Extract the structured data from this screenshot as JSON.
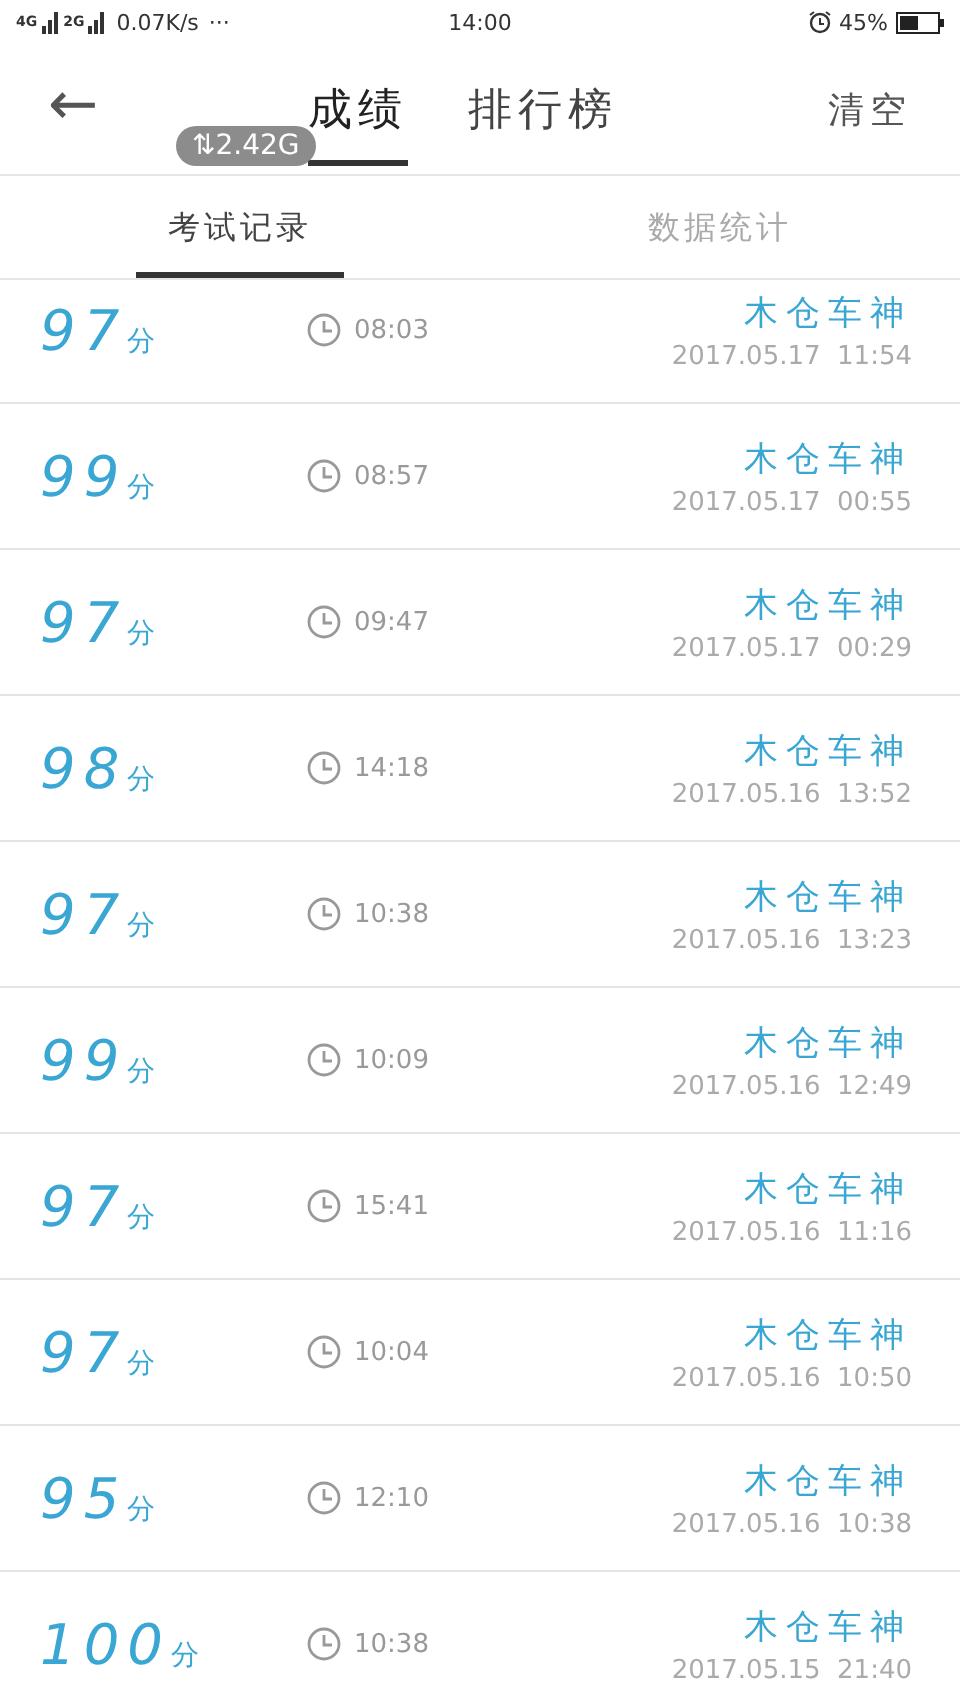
{
  "status_bar": {
    "networks": [
      "4G",
      "2G"
    ],
    "speed": "0.07K/s",
    "more": "···",
    "time": "14:00",
    "battery": "45%"
  },
  "header": {
    "back": "←",
    "tabs": [
      {
        "label": "成绩",
        "selected": true
      },
      {
        "label": "排行榜",
        "selected": false
      }
    ],
    "action": "清空"
  },
  "traffic_badge": {
    "icon": "⇅",
    "value": "2.42G"
  },
  "sub_tabs": [
    {
      "label": "考试记录",
      "selected": true
    },
    {
      "label": "数据统计",
      "selected": false
    }
  ],
  "records": [
    {
      "score": "97",
      "unit": "分",
      "duration": "08:03",
      "name": "木仓车神",
      "date": "2017.05.17  11:54"
    },
    {
      "score": "99",
      "unit": "分",
      "duration": "08:57",
      "name": "木仓车神",
      "date": "2017.05.17  00:55"
    },
    {
      "score": "97",
      "unit": "分",
      "duration": "09:47",
      "name": "木仓车神",
      "date": "2017.05.17  00:29"
    },
    {
      "score": "98",
      "unit": "分",
      "duration": "14:18",
      "name": "木仓车神",
      "date": "2017.05.16  13:52"
    },
    {
      "score": "97",
      "unit": "分",
      "duration": "10:38",
      "name": "木仓车神",
      "date": "2017.05.16  13:23"
    },
    {
      "score": "99",
      "unit": "分",
      "duration": "10:09",
      "name": "木仓车神",
      "date": "2017.05.16  12:49"
    },
    {
      "score": "97",
      "unit": "分",
      "duration": "15:41",
      "name": "木仓车神",
      "date": "2017.05.16  11:16"
    },
    {
      "score": "97",
      "unit": "分",
      "duration": "10:04",
      "name": "木仓车神",
      "date": "2017.05.16  10:50"
    },
    {
      "score": "95",
      "unit": "分",
      "duration": "12:10",
      "name": "木仓车神",
      "date": "2017.05.16  10:38"
    },
    {
      "score": "100",
      "unit": "分",
      "duration": "10:38",
      "name": "木仓车神",
      "date": "2017.05.15  21:40"
    }
  ]
}
